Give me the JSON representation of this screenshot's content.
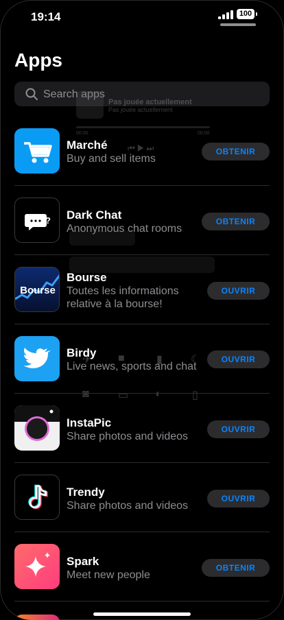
{
  "status": {
    "time": "19:14",
    "battery": "100"
  },
  "page_title": "Apps",
  "search": {
    "placeholder": "Search apps"
  },
  "overlay": {
    "now_playing_title": "Pas jouée actuellement",
    "now_playing_subtitle": "Pas jouée actuellement",
    "elapsed": "00:00",
    "remaining": "00:00"
  },
  "apps": [
    {
      "name": "Marché",
      "desc": "Buy and sell items",
      "action": "OBTENIR",
      "icon": "shopping-cart-icon",
      "color": "#0a9cf5"
    },
    {
      "name": "Dark Chat",
      "desc": "Anonymous chat rooms",
      "action": "OBTENIR",
      "icon": "chat-bubble-icon",
      "color": "#000000"
    },
    {
      "name": "Bourse",
      "desc": "Toutes les informations relative à la bourse!",
      "action": "OUVRIR",
      "icon": "stock-chart-icon",
      "label": "Bourse",
      "color": "#0b1f54"
    },
    {
      "name": "Birdy",
      "desc": "Live news, sports and chat",
      "action": "OUVRIR",
      "icon": "bird-icon",
      "color": "#1da1f2"
    },
    {
      "name": "InstaPic",
      "desc": "Share photos and videos",
      "action": "OUVRIR",
      "icon": "camera-lens-icon",
      "color": "#f0f0f0"
    },
    {
      "name": "Trendy",
      "desc": "Share photos and videos",
      "action": "OUVRIR",
      "icon": "music-note-icon",
      "color": "#000000"
    },
    {
      "name": "Spark",
      "desc": "Meet new people",
      "action": "OBTENIR",
      "icon": "sparkle-icon",
      "color": "#ff4d6d"
    }
  ]
}
